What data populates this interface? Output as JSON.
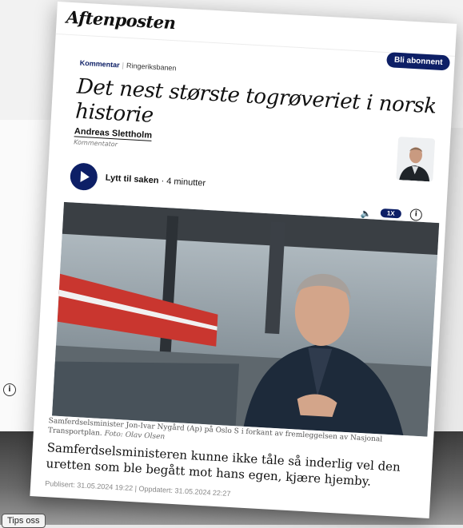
{
  "site": {
    "logo": "Aftenposten",
    "subscribe_label": "Bli abonnent"
  },
  "article": {
    "section": "Kommentar",
    "topic": "Ringeriksbanen",
    "title": "Det nest største togrøveriet i norsk historie",
    "author": "Andreas Slettholm",
    "author_role": "Kommentator",
    "lead": "Samferdselsministeren kunne ikke tåle så inderlig vel den uretten som ble begått mot hans egen, kjære hjemby.",
    "caption": "Samferdselsminister Jon-Ivar Nygård (Ap) på Oslo S i forkant av fremleggelsen av Nasjonal Transportplan.",
    "photo_credit": "Foto: Olav Olsen",
    "meta": "Publisert: 31.05.2024 19:22 | Oppdatert: 31.05.2024 22:27"
  },
  "audio": {
    "listen_label": "Lytt til saken",
    "duration": "· 4 minutter",
    "speed_label": "1X",
    "volume_icon": "speaker-icon",
    "info_icon": "info-icon"
  },
  "background": {
    "tips_label": "Tips oss"
  },
  "colors": {
    "brand_navy": "#0d1f66"
  }
}
